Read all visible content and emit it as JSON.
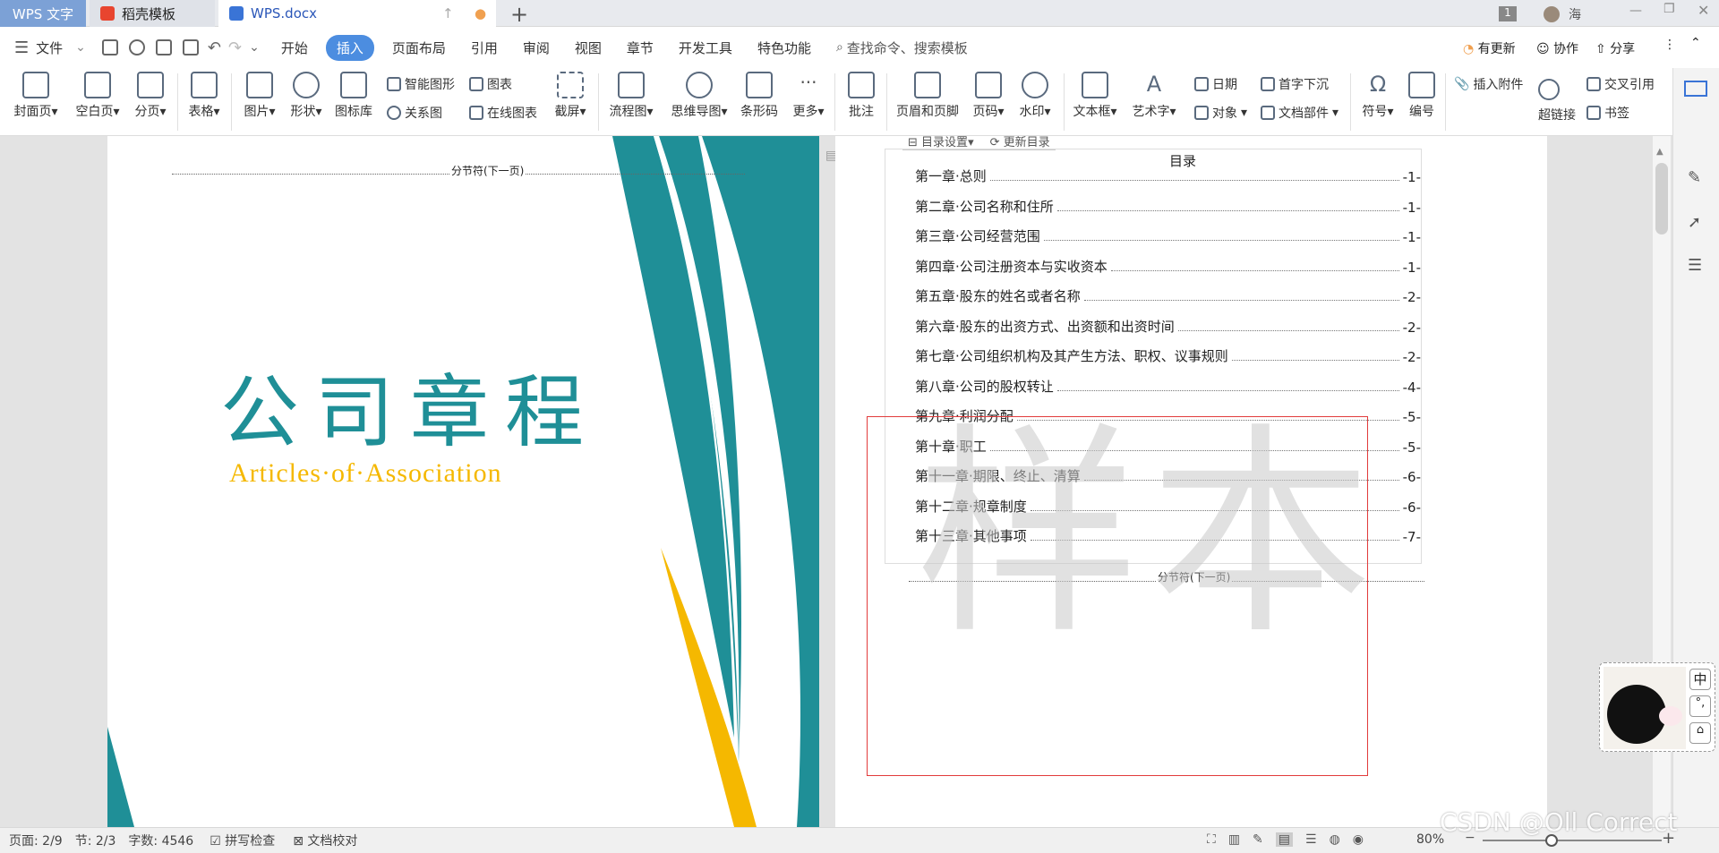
{
  "tabs": {
    "app": "WPS 文字",
    "template": "稻壳模板",
    "doc": "WPS.docx",
    "user": "海",
    "badge": "1"
  },
  "menu": {
    "file": "文件",
    "items": [
      "开始",
      "插入",
      "页面布局",
      "引用",
      "审阅",
      "视图",
      "章节",
      "开发工具",
      "特色功能"
    ],
    "active": "插入",
    "search": "查找命令、搜索模板",
    "update": "有更新",
    "collab": "协作",
    "share": "分享"
  },
  "ribbon": {
    "cover": "封面页",
    "blank": "空白页",
    "pagebreak": "分页",
    "table": "表格",
    "image": "图片",
    "shape": "形状",
    "iconlib": "图标库",
    "smartart": "智能图形",
    "relation": "关系图",
    "chart": "图表",
    "onlinechart": "在线图表",
    "screenshot": "截屏",
    "flow": "流程图",
    "mindmap": "思维导图",
    "barcode": "条形码",
    "more": "更多",
    "comment": "批注",
    "headerfooter": "页眉和页脚",
    "pagenum": "页码",
    "watermark": "水印",
    "textbox": "文本框",
    "wordart": "艺术字",
    "date": "日期",
    "object": "对象",
    "dropcap": "首字下沉",
    "docpart": "文档部件",
    "symbol": "符号",
    "numbering": "编号",
    "attach": "插入附件",
    "crossref": "交叉引用",
    "hyperlink": "超链接",
    "bookmark": "书签"
  },
  "page1": {
    "section_break": "分节符(下一页)",
    "title": "公司章程",
    "subtitle": "Articles·of·Association"
  },
  "page2": {
    "toc_btn1": "目录设置",
    "toc_btn2": "更新目录",
    "toc_title": "目录",
    "toc": [
      {
        "t": "第一章·总则",
        "p": "-1-"
      },
      {
        "t": "第二章·公司名称和住所",
        "p": "-1-"
      },
      {
        "t": "第三章·公司经营范围",
        "p": "-1-"
      },
      {
        "t": "第四章·公司注册资本与实收资本",
        "p": "-1-"
      },
      {
        "t": "第五章·股东的姓名或者名称",
        "p": "-2-"
      },
      {
        "t": "第六章·股东的出资方式、出资额和出资时间",
        "p": "-2-"
      },
      {
        "t": "第七章·公司组织机构及其产生方法、职权、议事规则",
        "p": "-2-"
      },
      {
        "t": "第八章·公司的股权转让",
        "p": "-4-"
      },
      {
        "t": "第九章·利润分配",
        "p": "-5-"
      },
      {
        "t": "第十章·职工",
        "p": "-5-"
      },
      {
        "t": "第十一章·期限、终止、清算",
        "p": "-6-"
      },
      {
        "t": "第十二章·规章制度",
        "p": "-6-"
      },
      {
        "t": "第十三章·其他事项",
        "p": "-7-"
      }
    ],
    "section_break": "分节符(下一页)",
    "watermark": "样本"
  },
  "ime": {
    "a": "中",
    "b": "°,"
  },
  "status": {
    "page": "页面: 2/9",
    "section": "节: 2/3",
    "words": "字数: 4546",
    "spell": "拼写检查",
    "proof": "文档校对",
    "zoom": "80%"
  },
  "overlay": "CSDN @Oll Correct",
  "colors": {
    "teal": "#1f8f97",
    "gold": "#f5b800",
    "accent": "#4c8de0"
  }
}
